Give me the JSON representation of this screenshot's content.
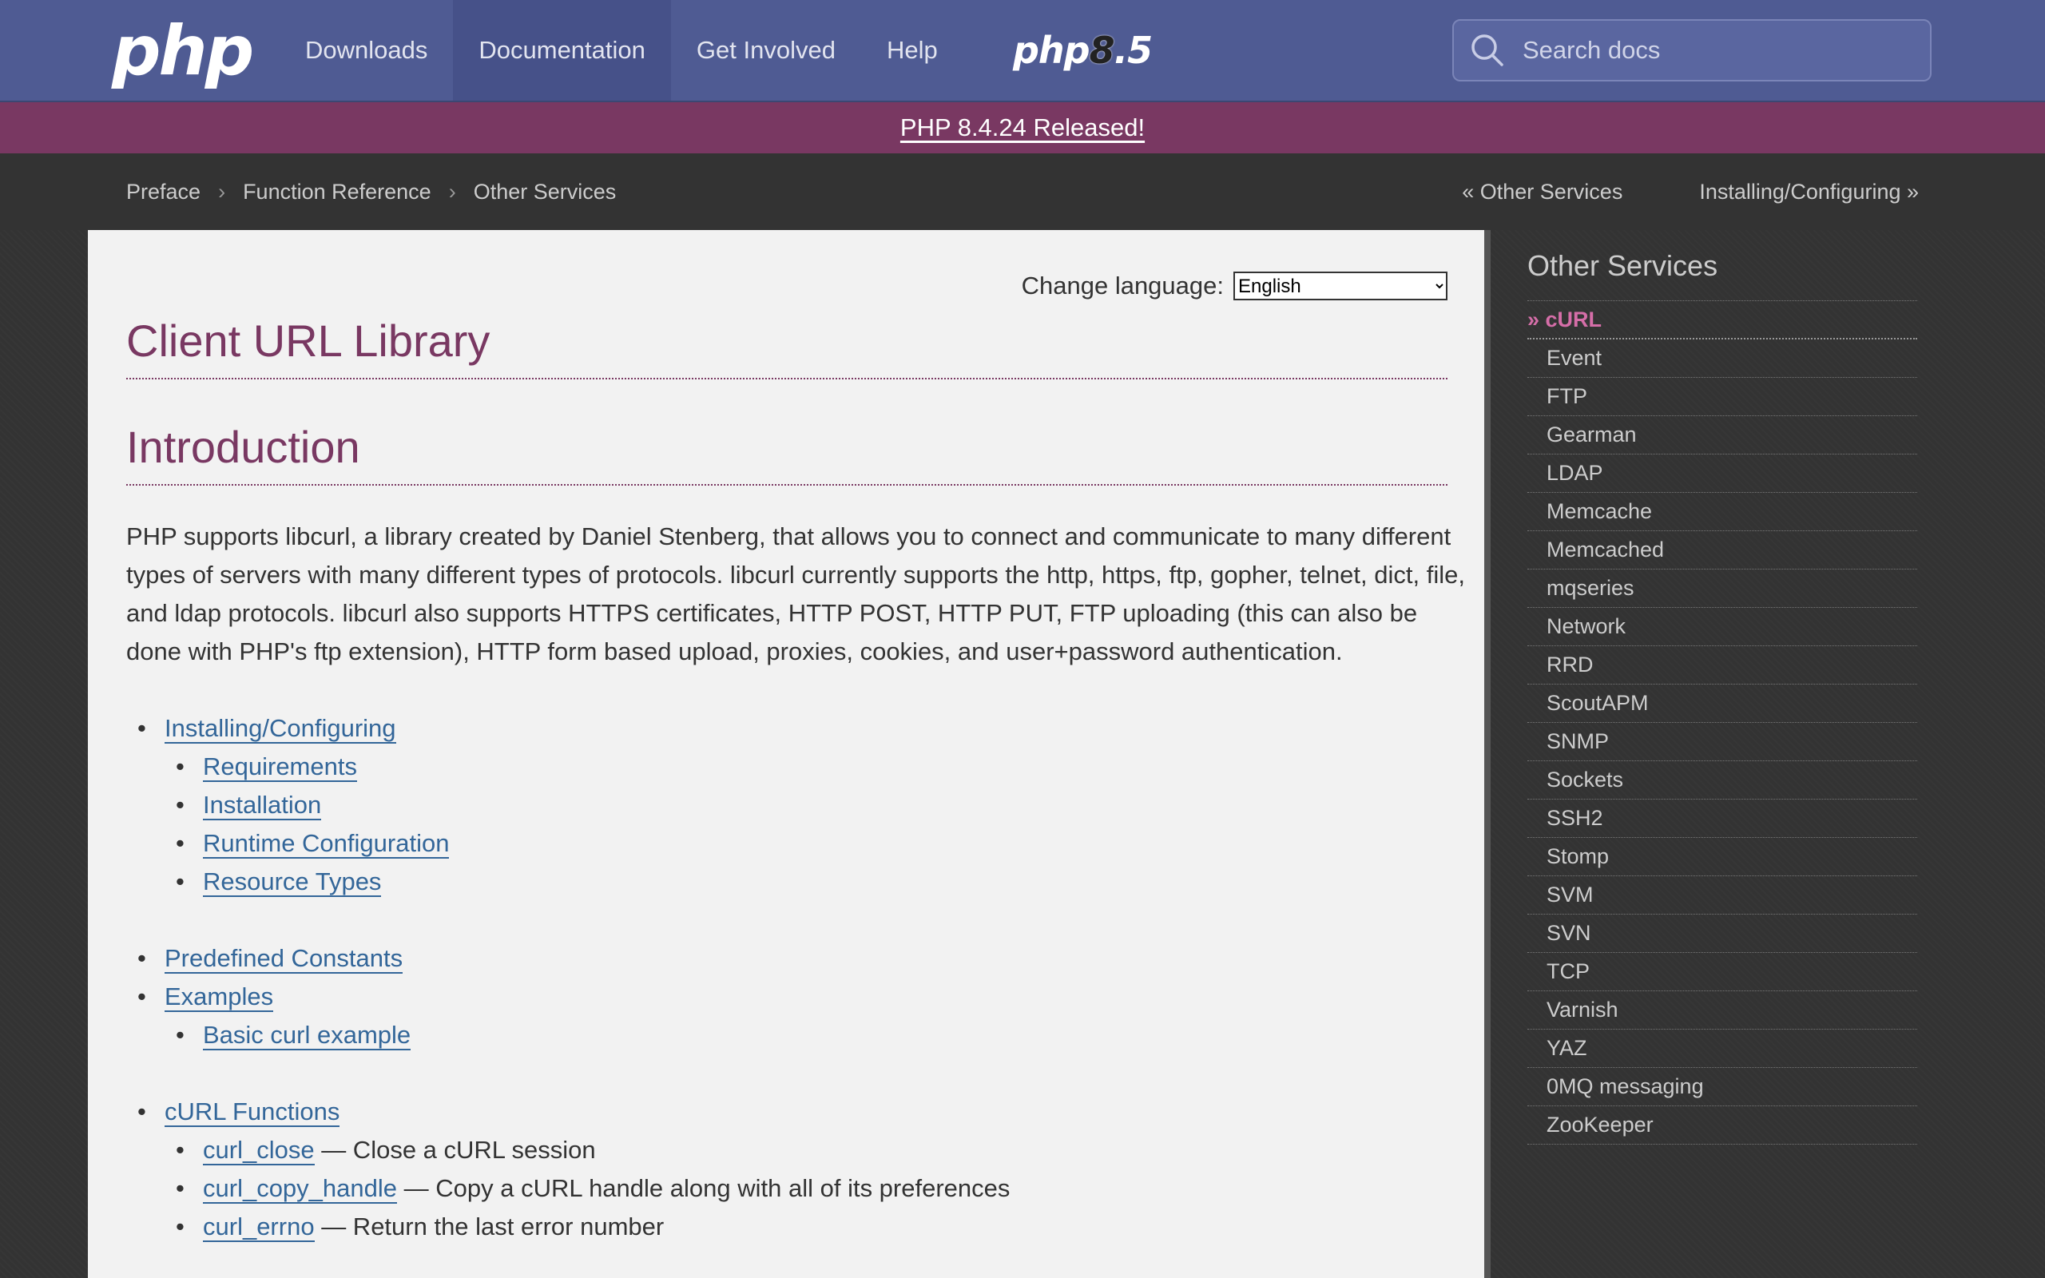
{
  "nav": {
    "logo": "php",
    "links": [
      "Downloads",
      "Documentation",
      "Get Involved",
      "Help"
    ],
    "release_logo": {
      "prefix": "php",
      "eight": "8",
      "suffix": ".5"
    },
    "search_placeholder": "Search docs"
  },
  "announcement": "PHP 8.4.24 Released!",
  "breadcrumbs": [
    "Preface",
    "Function Reference",
    "Other Services"
  ],
  "pager": {
    "prev": "« Other Services",
    "next": "Installing/Configuring »"
  },
  "content": {
    "change_language_label": "Change language:",
    "language_selected": "English",
    "title": "Client URL Library",
    "intro_heading": "Introduction",
    "intro_text": "PHP supports libcurl, a library created by Daniel Stenberg, that allows you to connect and communicate to many different types of servers with many different types of protocols. libcurl currently supports the http, https, ftp, gopher, telnet, dict, file, and ldap protocols. libcurl also supports HTTPS certificates, HTTP POST, HTTP PUT, FTP uploading (this can also be done with PHP's ftp extension), HTTP form based upload, proxies, cookies, and user+password authentication.",
    "toc": [
      {
        "label": "Installing/Configuring",
        "children": [
          {
            "label": "Requirements"
          },
          {
            "label": "Installation"
          },
          {
            "label": "Runtime Configuration"
          },
          {
            "label": "Resource Types"
          }
        ]
      },
      {
        "label": "Predefined Constants",
        "children": []
      },
      {
        "label": "Examples",
        "children": [
          {
            "label": "Basic curl example"
          }
        ]
      },
      {
        "label": "cURL Functions",
        "children": [
          {
            "label": "curl_close",
            "desc": "— Close a cURL session"
          },
          {
            "label": "curl_copy_handle",
            "desc": "— Copy a cURL handle along with all of its preferences"
          },
          {
            "label": "curl_errno",
            "desc": "— Return the last error number"
          }
        ]
      }
    ]
  },
  "sidebar": {
    "title": "Other Services",
    "current": "» cURL",
    "items": [
      "Event",
      "FTP",
      "Gearman",
      "LDAP",
      "Memcache",
      "Memcached",
      "mqseries",
      "Network",
      "RRD",
      "ScoutAPM",
      "SNMP",
      "Sockets",
      "SSH2",
      "Stomp",
      "SVM",
      "SVN",
      "TCP",
      "Varnish",
      "YAZ",
      "0MQ messaging",
      "ZooKeeper"
    ]
  },
  "colors": {
    "nav_bg": "#4f5b93",
    "announce_bg": "#793862",
    "heading": "#793862",
    "link": "#336699",
    "sidebar_current": "#d56ea8"
  }
}
